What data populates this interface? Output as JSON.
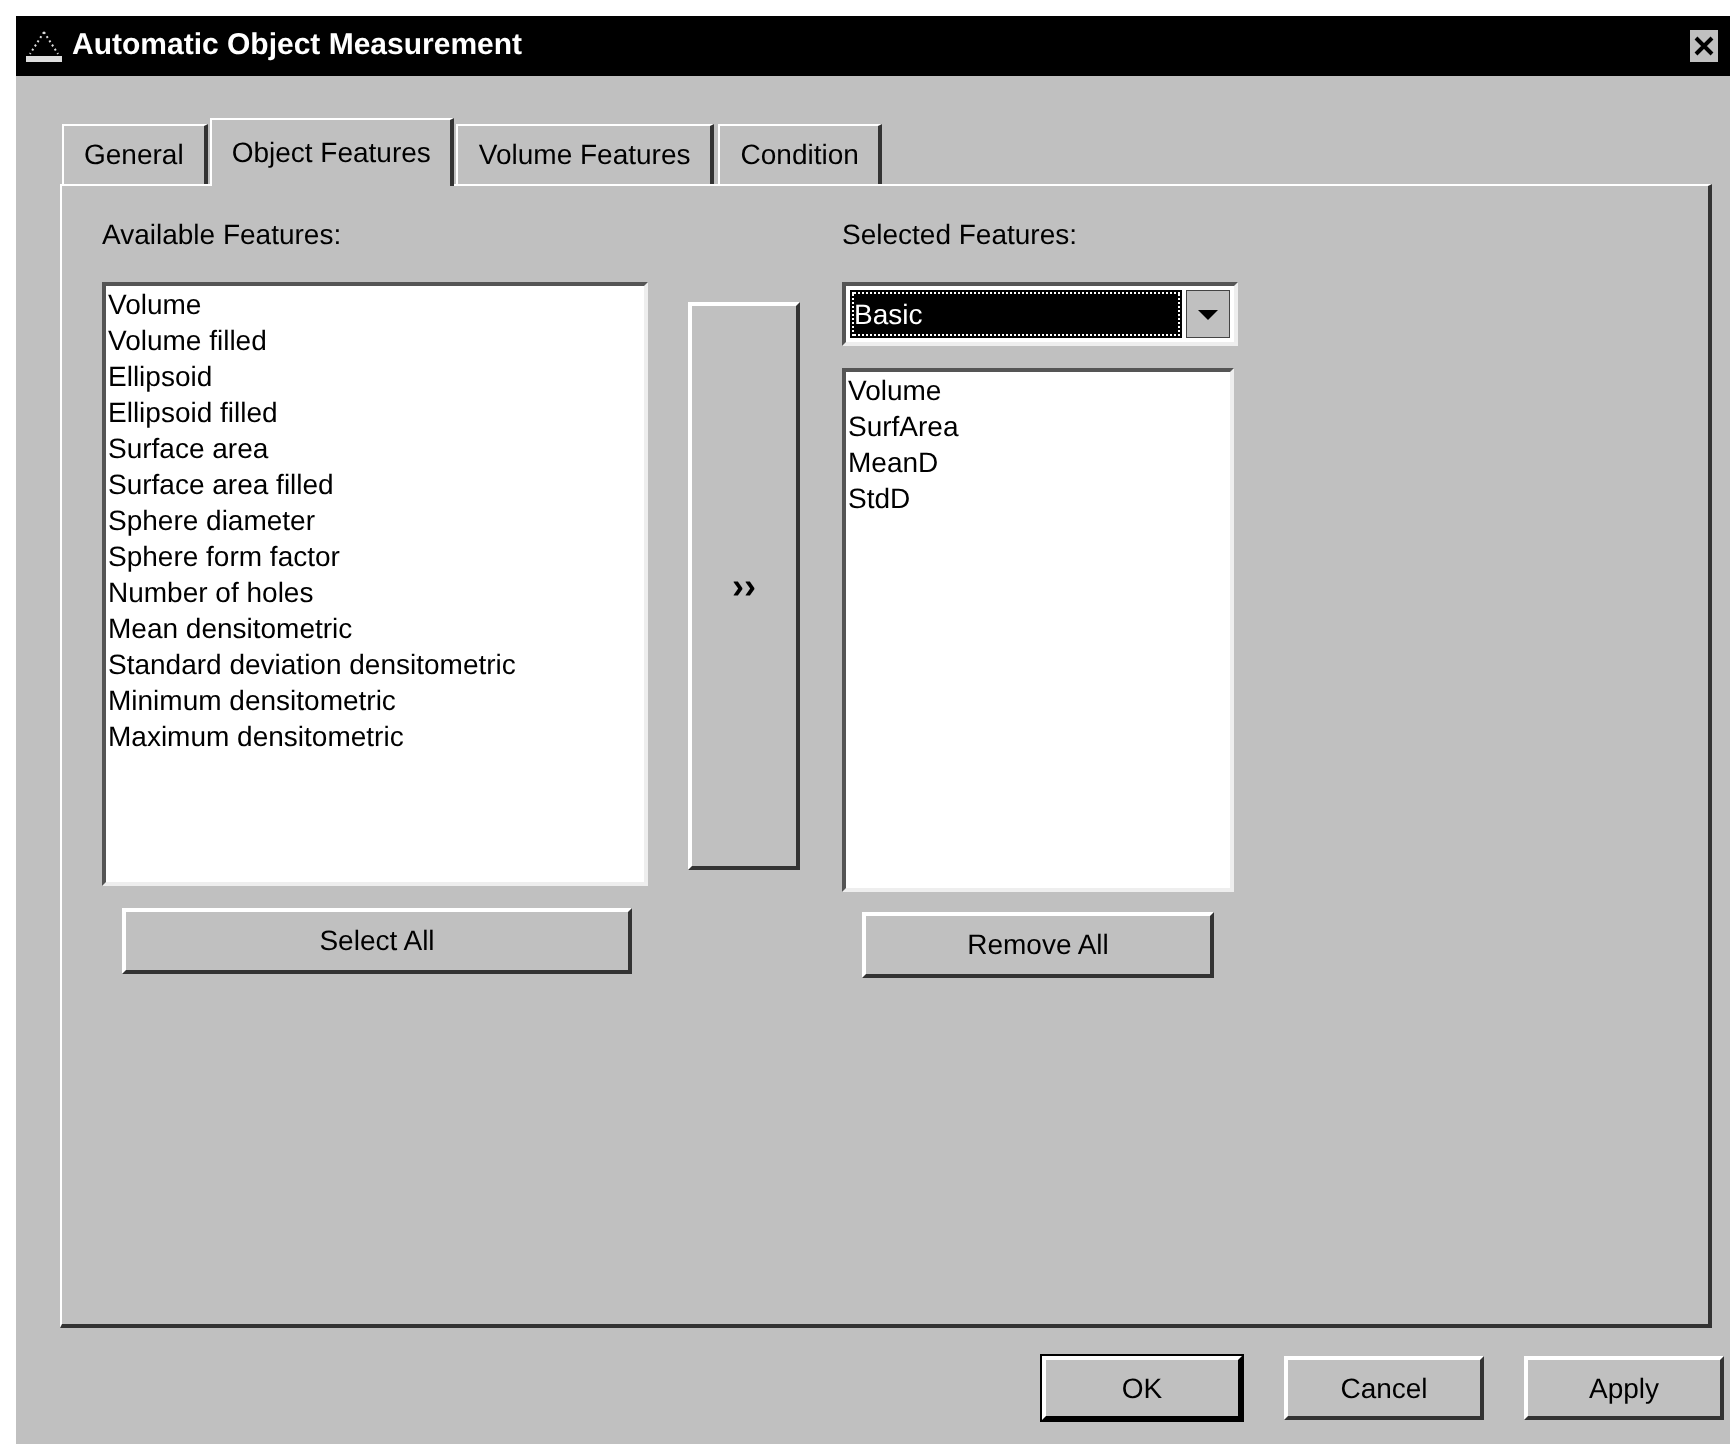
{
  "window": {
    "title": "Automatic Object Measurement"
  },
  "tabs": [
    {
      "label": "General",
      "selected": false
    },
    {
      "label": "Object Features",
      "selected": true
    },
    {
      "label": "Volume Features",
      "selected": false
    },
    {
      "label": "Condition",
      "selected": false
    }
  ],
  "available": {
    "label": "Available Features:",
    "items": [
      "Volume",
      "Volume filled",
      "Ellipsoid",
      "Ellipsoid filled",
      "Surface area",
      "Surface area filled",
      "Sphere diameter",
      "Sphere form factor",
      "Number of holes",
      "Mean densitometric",
      "Standard deviation densitometric",
      "Minimum densitometric",
      "Maximum densitometric"
    ],
    "button": "Select All"
  },
  "move_button": "››",
  "selected": {
    "label": "Selected Features:",
    "preset": {
      "value": "Basic"
    },
    "items": [
      "Volume",
      "SurfArea",
      "MeanD",
      "StdD"
    ],
    "button": "Remove All"
  },
  "buttons": [
    {
      "label": "OK",
      "default": true
    },
    {
      "label": "Cancel",
      "default": false
    },
    {
      "label": "Apply",
      "default": false
    }
  ]
}
